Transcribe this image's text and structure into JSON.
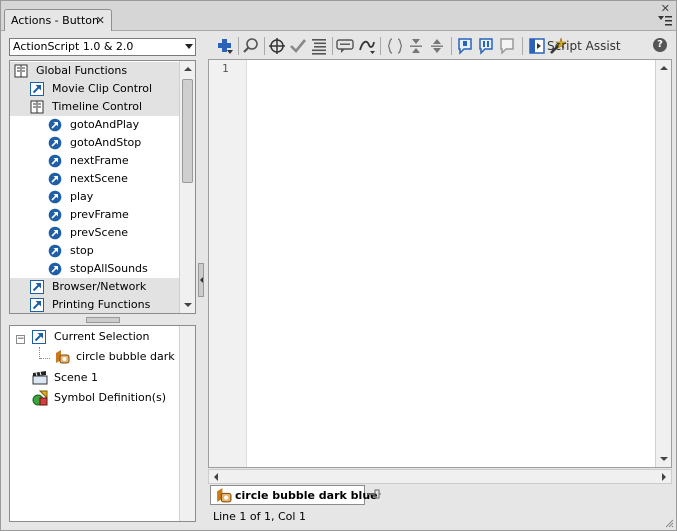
{
  "window": {
    "tab_title": "Actions - Button",
    "tab_close": "✕",
    "panel_close": "✕"
  },
  "toolbox": {
    "version_value": "ActionScript 1.0 & 2.0",
    "items": [
      {
        "label": "Global Functions",
        "icon": "book-open-icon",
        "kind": "category"
      },
      {
        "label": "Movie Clip Control",
        "icon": "book-closed-icon",
        "kind": "category"
      },
      {
        "label": "Timeline Control",
        "icon": "book-open-icon",
        "kind": "category"
      },
      {
        "label": "gotoAndPlay",
        "icon": "action-arrow-icon",
        "kind": "action"
      },
      {
        "label": "gotoAndStop",
        "icon": "action-arrow-icon",
        "kind": "action"
      },
      {
        "label": "nextFrame",
        "icon": "action-arrow-icon",
        "kind": "action"
      },
      {
        "label": "nextScene",
        "icon": "action-arrow-icon",
        "kind": "action"
      },
      {
        "label": "play",
        "icon": "action-arrow-icon",
        "kind": "action"
      },
      {
        "label": "prevFrame",
        "icon": "action-arrow-icon",
        "kind": "action"
      },
      {
        "label": "prevScene",
        "icon": "action-arrow-icon",
        "kind": "action"
      },
      {
        "label": "stop",
        "icon": "action-arrow-icon",
        "kind": "action"
      },
      {
        "label": "stopAllSounds",
        "icon": "action-arrow-icon",
        "kind": "action"
      },
      {
        "label": "Browser/Network",
        "icon": "book-closed-icon",
        "kind": "category"
      },
      {
        "label": "Printing Functions",
        "icon": "book-closed-icon",
        "kind": "category"
      }
    ]
  },
  "navigator": {
    "current_selection_label": "Current Selection",
    "current_selection_item": "circle bubble dark ...",
    "scene_label": "Scene 1",
    "symbol_definitions_label": "Symbol Definition(s)",
    "expander_symbol": "−"
  },
  "toolbar": {
    "script_assist_label": "Script Assist",
    "help_label": "?",
    "buttons": [
      "add-statement-icon",
      "find-icon",
      "target-path-icon",
      "check-syntax-icon",
      "auto-format-icon",
      "code-hint-icon",
      "debug-options-icon",
      "collapse-braces-icon",
      "collapse-selection-icon",
      "expand-all-icon",
      "apply-block-comment-icon",
      "apply-line-comment-icon",
      "remove-comment-icon",
      "show-hide-toolbox-icon"
    ]
  },
  "editor": {
    "line_number": "1",
    "content": ""
  },
  "script_tab": {
    "label": "circle bubble dark blue"
  },
  "status": {
    "text": "Line 1 of 1, Col 1"
  },
  "colors": {
    "panel_bg": "#e6e6e6",
    "icon_blue": "#1f5fa8",
    "category_bg": "#e2e2e2"
  }
}
